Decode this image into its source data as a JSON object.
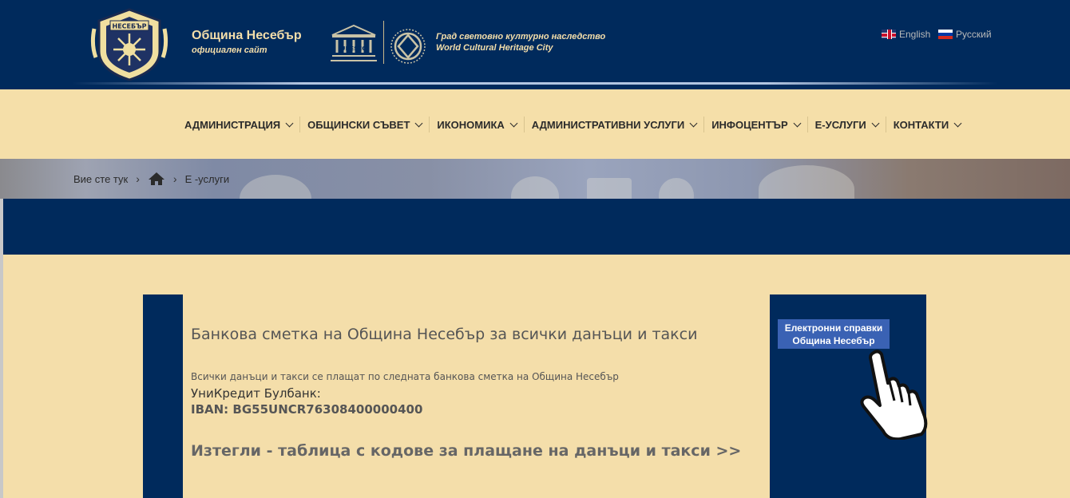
{
  "header": {
    "site_name": "Община Несебър",
    "site_sub": "официален сайт",
    "crest_text": "НЕСЕБЪР",
    "unesco_text": "UNESCO",
    "heritage_bg": "Град световно културно наследство",
    "heritage_en": "World Cultural Heritage City",
    "languages": [
      {
        "label": "English",
        "flag": "uk-flag-icon"
      },
      {
        "label": "Русский",
        "flag": "ru-flag-icon"
      }
    ]
  },
  "nav": {
    "items": [
      {
        "label": "АДМИНИСТРАЦИЯ"
      },
      {
        "label": "ОБЩИНСКИ СЪВЕТ"
      },
      {
        "label": "ИКОНОМИКА"
      },
      {
        "label": "АДМИНИСТРАТИВНИ УСЛУГИ"
      },
      {
        "label": "ИНФОЦЕНТЪР"
      },
      {
        "label": "Е-УСЛУГИ"
      },
      {
        "label": "КОНТАКТИ"
      }
    ]
  },
  "breadcrumb": {
    "prefix": "Вие сте тук",
    "separator": "›",
    "current": "Е -услуги"
  },
  "content": {
    "title": "Банкова сметка на Община Несебър за всички данъци и такси",
    "text": "Всички данъци и такси се плащат по следната банкова сметка на Община Несебър",
    "bank": "УниКредит Булбанк:",
    "iban": "IBAN: BG55UNCR76308400000400",
    "download": "Изтегли - таблица с кодове за плащане на данъци и такси >>"
  },
  "sidebar": {
    "button_line1": "Електронни справки",
    "button_line2": "Община Несебър"
  },
  "colors": {
    "navy": "#002a5c",
    "cream": "#f4deaa",
    "button_blue": "#3a62b4"
  }
}
